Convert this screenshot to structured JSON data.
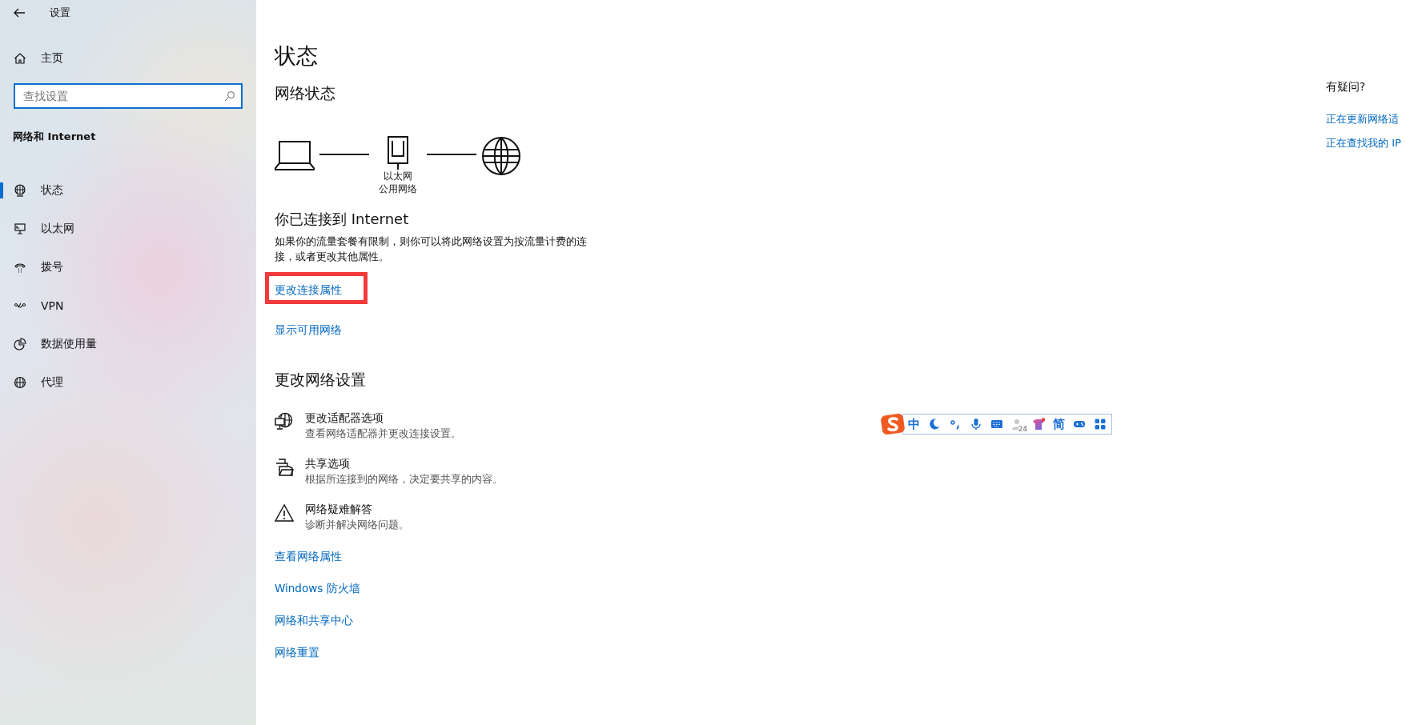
{
  "window": {
    "title": "设置"
  },
  "sidebar": {
    "home": "主页",
    "search": {
      "placeholder": "查找设置"
    },
    "section": "网络和 Internet",
    "items": [
      {
        "label": "状态",
        "kind": "status",
        "selected": true
      },
      {
        "label": "以太网",
        "kind": "ethernet",
        "selected": false
      },
      {
        "label": "拨号",
        "kind": "dialup",
        "selected": false
      },
      {
        "label": "VPN",
        "kind": "vpn",
        "selected": false
      },
      {
        "label": "数据使用量",
        "kind": "data",
        "selected": false
      },
      {
        "label": "代理",
        "kind": "proxy",
        "selected": false
      }
    ]
  },
  "main": {
    "title": "状态",
    "network_status": {
      "heading": "网络状态",
      "adapter": "以太网",
      "profile": "公用网络"
    },
    "connected": {
      "heading": "你已连接到 Internet",
      "text": "如果你的流量套餐有限制，则你可以将此网络设置为按流量计费的连接，或者更改其他属性。"
    },
    "links": [
      {
        "label": "更改连接属性",
        "highlighted": true
      },
      {
        "label": "显示可用网络",
        "highlighted": false
      }
    ],
    "change_heading": "更改网络设置",
    "settings": [
      {
        "kind": "adapter",
        "title": "更改适配器选项",
        "description": "查看网络适配器并更改连接设置。"
      },
      {
        "kind": "sharing",
        "title": "共享选项",
        "description": "根据所连接到的网络，决定要共享的内容。"
      },
      {
        "kind": "troubleshoot",
        "title": "网络疑难解答",
        "description": "诊断并解决网络问题。"
      }
    ],
    "bottom_links": [
      "查看网络属性",
      "Windows 防火墙",
      "网络和共享中心",
      "网络重置"
    ]
  },
  "help": {
    "heading": "有疑问?",
    "links": [
      "正在更新网络适",
      "正在查找我的 IP"
    ]
  },
  "ime_toolbar": {
    "items": [
      {
        "kind": "logo"
      },
      {
        "kind": "text",
        "label": "中"
      },
      {
        "kind": "moon"
      },
      {
        "kind": "punct"
      },
      {
        "kind": "mic"
      },
      {
        "kind": "keyboard"
      },
      {
        "kind": "user",
        "badge": "24"
      },
      {
        "kind": "shirt"
      },
      {
        "kind": "text",
        "label": "简"
      },
      {
        "kind": "gamepad"
      },
      {
        "kind": "grid"
      }
    ]
  }
}
